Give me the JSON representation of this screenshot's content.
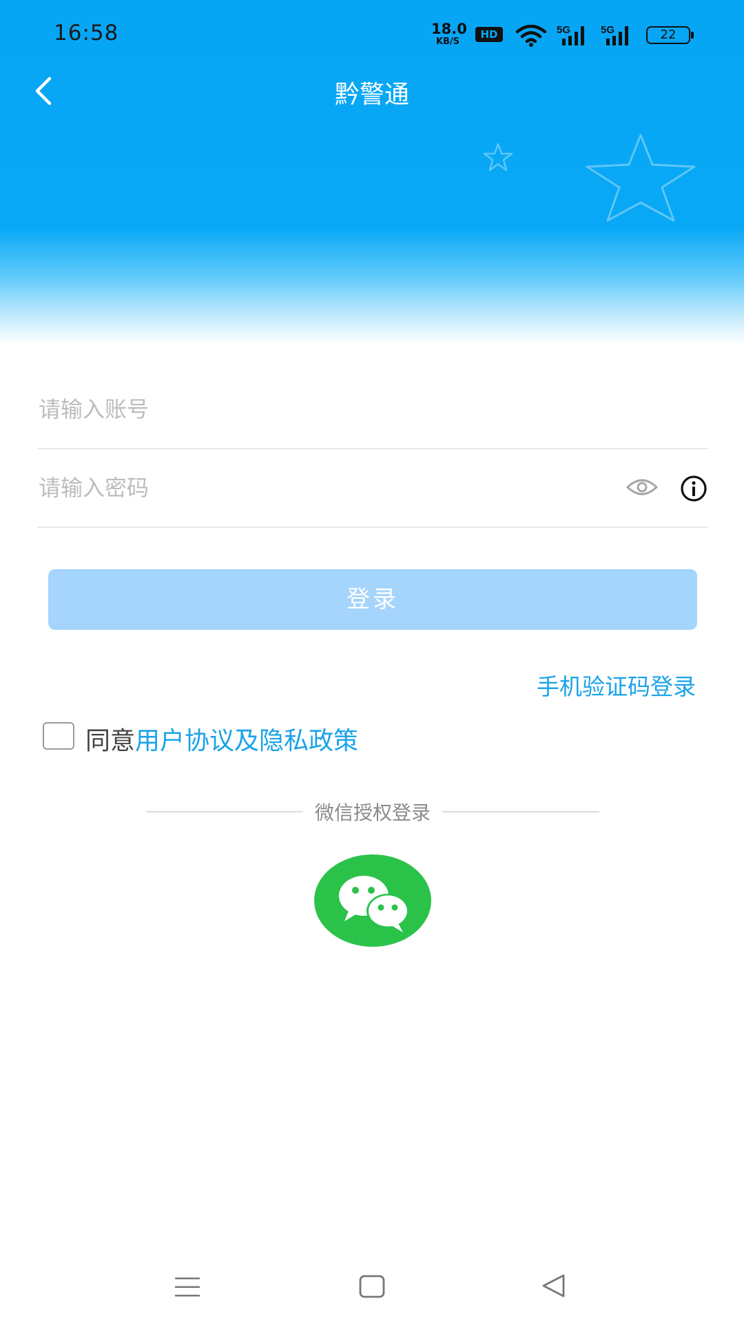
{
  "status_bar": {
    "time": "16:58",
    "net_speed_value": "18.0",
    "net_speed_unit": "KB/S",
    "hd_badge": "HD",
    "signal_1_label": "5G",
    "signal_2_label": "5G",
    "battery_level": "22"
  },
  "header": {
    "title": "黔警通"
  },
  "form": {
    "account_placeholder": "请输入账号",
    "account_value": "",
    "password_placeholder": "请输入密码",
    "password_value": "",
    "login_label": "登录",
    "sms_login_label": "手机验证码登录"
  },
  "agreement": {
    "prefix": "同意",
    "link_label": "用户协议及隐私政策",
    "checked": false
  },
  "wechat": {
    "divider_label": "微信授权登录"
  },
  "colors": {
    "header_blue": "#08a8f6",
    "button_disabled": "#a5d4fc",
    "link_blue": "#1aa3e8",
    "wechat_green": "#2bc24a"
  }
}
